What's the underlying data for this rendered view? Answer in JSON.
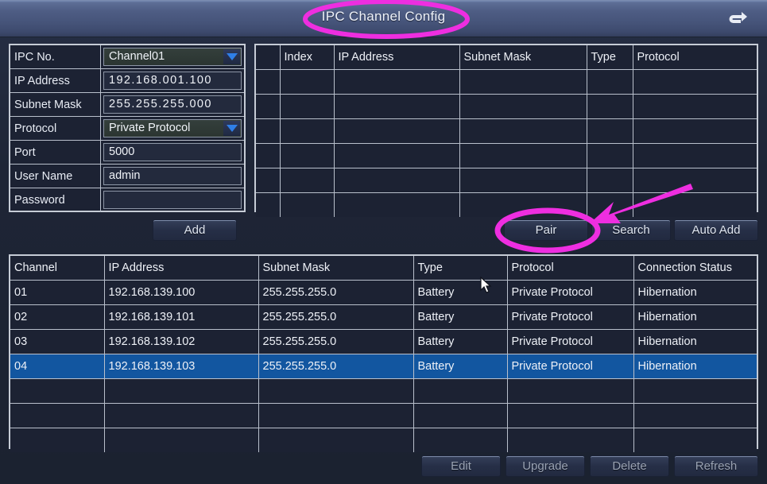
{
  "window": {
    "title": "IPC Channel Config",
    "back_icon": "back-arrow-icon"
  },
  "form": {
    "rows": [
      {
        "label": "IPC No.",
        "value": "Channel01",
        "kind": "select"
      },
      {
        "label": "IP Address",
        "value": "192.168.001.100",
        "kind": "ip"
      },
      {
        "label": "Subnet Mask",
        "value": "255.255.255.000",
        "kind": "ip"
      },
      {
        "label": "Protocol",
        "value": "Private Protocol",
        "kind": "select"
      },
      {
        "label": "Port",
        "value": "5000",
        "kind": "text"
      },
      {
        "label": "User Name",
        "value": "admin",
        "kind": "text"
      },
      {
        "label": "Password",
        "value": "",
        "kind": "password"
      }
    ],
    "add_button": "Add"
  },
  "discovery": {
    "columns": [
      "",
      "Index",
      "IP Address",
      "Subnet Mask",
      "Type",
      "Protocol"
    ],
    "rows": [],
    "empty_row_count": 6,
    "buttons": {
      "pair": "Pair",
      "search": "Search",
      "auto_add": "Auto Add"
    }
  },
  "channels": {
    "columns": [
      "Channel",
      "IP Address",
      "Subnet Mask",
      "Type",
      "Protocol",
      "Connection Status"
    ],
    "rows": [
      {
        "channel": "01",
        "ip": "192.168.139.100",
        "mask": "255.255.255.0",
        "type": "Battery",
        "protocol": "Private Protocol",
        "status": "Hibernation",
        "selected": false
      },
      {
        "channel": "02",
        "ip": "192.168.139.101",
        "mask": "255.255.255.0",
        "type": "Battery",
        "protocol": "Private Protocol",
        "status": "Hibernation",
        "selected": false
      },
      {
        "channel": "03",
        "ip": "192.168.139.102",
        "mask": "255.255.255.0",
        "type": "Battery",
        "protocol": "Private Protocol",
        "status": "Hibernation",
        "selected": false
      },
      {
        "channel": "04",
        "ip": "192.168.139.103",
        "mask": "255.255.255.0",
        "type": "Battery",
        "protocol": "Private Protocol",
        "status": "Hibernation",
        "selected": true
      }
    ],
    "empty_row_count": 3
  },
  "footer": {
    "buttons": {
      "edit": "Edit",
      "upgrade": "Upgrade",
      "delete": "Delete",
      "refresh": "Refresh"
    }
  },
  "annotations": {
    "color": "#ee2ee0",
    "title_highlight": "ellipse around IPC Channel Config title",
    "pair_highlight": "ellipse around Pair button",
    "arrow": "arrow pointing to Pair button"
  },
  "colors": {
    "selection_blue": "#1256a0",
    "accent_magenta": "#ee2ee0",
    "panel_bg": "#1c2233",
    "grid_line": "#b9c0cc"
  }
}
